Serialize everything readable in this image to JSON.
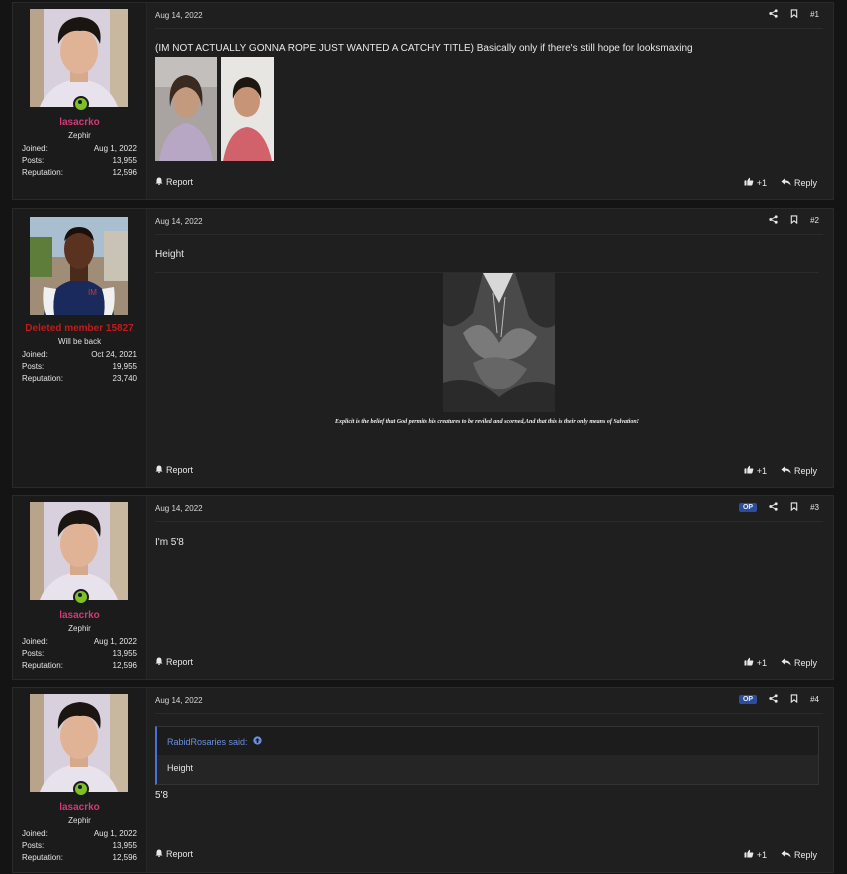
{
  "posts": [
    {
      "username": "lasacrko",
      "user_title": "Zephir",
      "joined_label": "Joined:",
      "joined": "Aug 1, 2022",
      "posts_label": "Posts:",
      "posts": "13,955",
      "rep_label": "Reputation:",
      "rep": "12,596",
      "date": "Aug 14, 2022",
      "number": "#1",
      "body": "(IM NOT ACTUALLY GONNA ROPE JUST WANTED A CATCHY TITLE) Basically only if there's still hope for looksmaxing",
      "report": "Report",
      "like_count": "+1",
      "reply": "Reply"
    },
    {
      "username": "Deleted member 15827",
      "user_title": "Will be back",
      "joined_label": "Joined:",
      "joined": "Oct 24, 2021",
      "posts_label": "Posts:",
      "posts": "19,955",
      "rep_label": "Reputation:",
      "rep": "23,740",
      "date": "Aug 14, 2022",
      "number": "#2",
      "body": "Height",
      "signature": "Explicit is the belief that God permits his creatures to be reviled and scorned,And that this is their only means of Salvation!",
      "report": "Report",
      "like_count": "+1",
      "reply": "Reply"
    },
    {
      "username": "lasacrko",
      "user_title": "Zephir",
      "joined_label": "Joined:",
      "joined": "Aug 1, 2022",
      "posts_label": "Posts:",
      "posts": "13,955",
      "rep_label": "Reputation:",
      "rep": "12,596",
      "date": "Aug 14, 2022",
      "op_badge": "OP",
      "number": "#3",
      "body": "I'm 5'8",
      "report": "Report",
      "like_count": "+1",
      "reply": "Reply"
    },
    {
      "username": "lasacrko",
      "user_title": "Zephir",
      "joined_label": "Joined:",
      "joined": "Aug 1, 2022",
      "posts_label": "Posts:",
      "posts": "13,955",
      "rep_label": "Reputation:",
      "rep": "12,596",
      "date": "Aug 14, 2022",
      "op_badge": "OP",
      "number": "#4",
      "quote_author": "RabidRosaries said:",
      "quote_text": "Height",
      "body": "5'8",
      "report": "Report",
      "like_count": "+1",
      "reply": "Reply"
    }
  ],
  "colors": {
    "username": "#d23a7a",
    "deleted_username": "#c21b1b",
    "op_badge": "#2b4d9a",
    "quote_accent": "#4a6fd8",
    "online": "#7fbf2a"
  }
}
